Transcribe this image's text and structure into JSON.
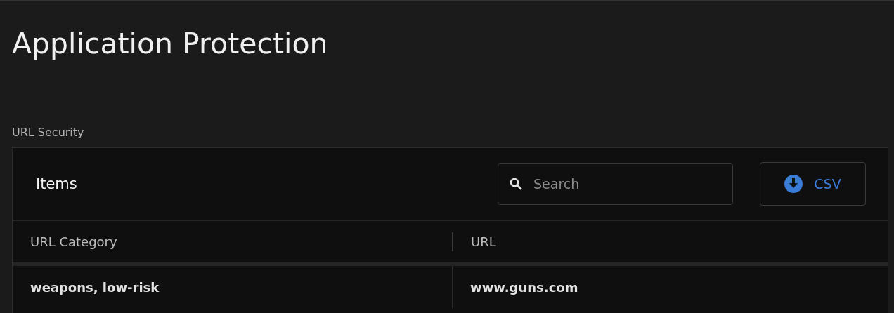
{
  "page": {
    "title": "Application Protection"
  },
  "section": {
    "label": "URL Security"
  },
  "panel": {
    "title": "Items",
    "search": {
      "placeholder": "Search"
    },
    "export_button": "CSV"
  },
  "table": {
    "columns": [
      "URL Category",
      "URL"
    ],
    "rows": [
      [
        "weapons, low-risk",
        "www.guns.com"
      ]
    ]
  }
}
